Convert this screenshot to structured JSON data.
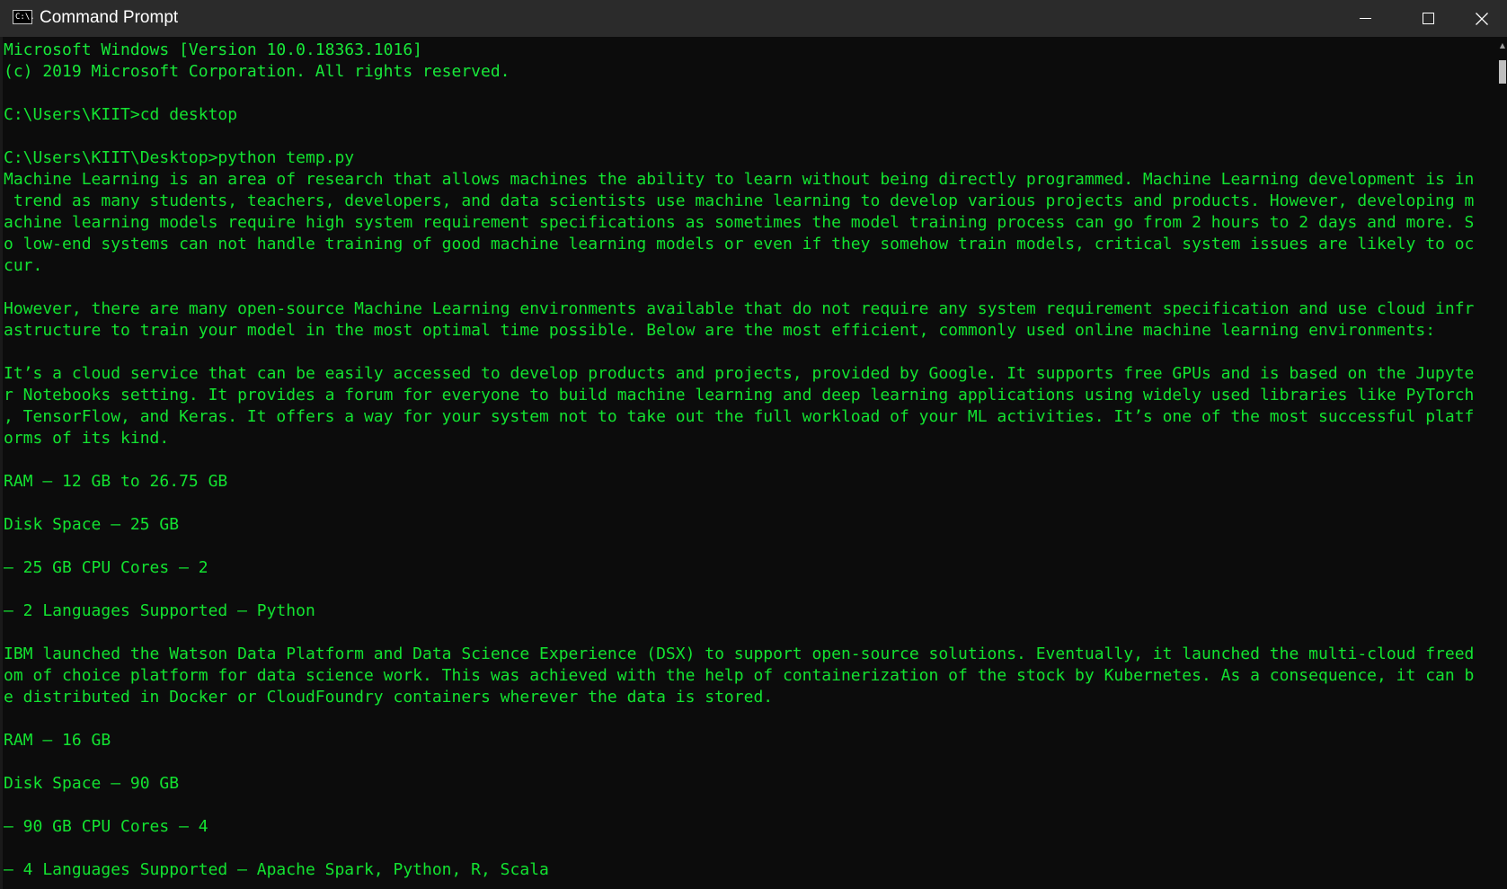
{
  "window": {
    "title": "Command Prompt",
    "icon": "cmd-app-icon",
    "icon_label": "C:\\.",
    "controls": {
      "minimize": "minimize-icon",
      "maximize": "maximize-icon",
      "close": "close-icon"
    }
  },
  "colors": {
    "titlebar": "#2b2b2b",
    "console_bg": "#0c0c0c",
    "console_text": "#13e331"
  },
  "console": {
    "lines": [
      "Microsoft Windows [Version 10.0.18363.1016]",
      "(c) 2019 Microsoft Corporation. All rights reserved.",
      "",
      "C:\\Users\\KIIT>cd desktop",
      "",
      "C:\\Users\\KIIT\\Desktop>python temp.py",
      "Machine Learning is an area of research that allows machines the ability to learn without being directly programmed. Machine Learning development is in",
      " trend as many students, teachers, developers, and data scientists use machine learning to develop various projects and products. However, developing m",
      "achine learning models require high system requirement specifications as sometimes the model training process can go from 2 hours to 2 days and more. S",
      "o low-end systems can not handle training of good machine learning models or even if they somehow train models, critical system issues are likely to oc",
      "cur.",
      "",
      "However, there are many open-source Machine Learning environments available that do not require any system requirement specification and use cloud infr",
      "astructure to train your model in the most optimal time possible. Below are the most efficient, commonly used online machine learning environments:",
      "",
      "It’s a cloud service that can be easily accessed to develop products and projects, provided by Google. It supports free GPUs and is based on the Jupyte",
      "r Notebooks setting. It provides a forum for everyone to build machine learning and deep learning applications using widely used libraries like PyTorch",
      ", TensorFlow, and Keras. It offers a way for your system not to take out the full workload of your ML activities. It’s one of the most successful platf",
      "orms of its kind.",
      "",
      "RAM – 12 GB to 26.75 GB",
      "",
      "Disk Space – 25 GB",
      "",
      "– 25 GB CPU Cores – 2",
      "",
      "– 2 Languages Supported – Python",
      "",
      "IBM launched the Watson Data Platform and Data Science Experience (DSX) to support open-source solutions. Eventually, it launched the multi-cloud freed",
      "om of choice platform for data science work. This was achieved with the help of containerization of the stock by Kubernetes. As a consequence, it can b",
      "e distributed in Docker or CloudFoundry containers wherever the data is stored.",
      "",
      "RAM – 16 GB",
      "",
      "Disk Space – 90 GB",
      "",
      "– 90 GB CPU Cores – 4",
      "",
      "– 4 Languages Supported – Apache Spark, Python, R, Scala"
    ]
  },
  "scrollbar": {
    "up_arrow": "scroll-up-arrow-icon"
  }
}
